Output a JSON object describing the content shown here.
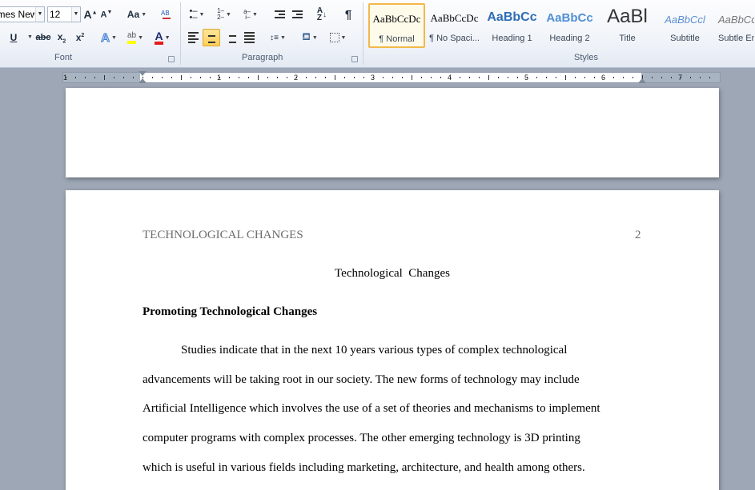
{
  "font_group": {
    "label": "Font",
    "font_name": "Times New Roman",
    "font_size": "12"
  },
  "paragraph_group": {
    "label": "Paragraph"
  },
  "styles_group": {
    "label": "Styles",
    "styles": [
      {
        "sample": "AaBbCcDc",
        "name": "¶ Normal"
      },
      {
        "sample": "AaBbCcDc",
        "name": "¶ No Spaci..."
      },
      {
        "sample": "AaBbCc",
        "name": "Heading 1"
      },
      {
        "sample": "AaBbCc",
        "name": "Heading 2"
      },
      {
        "sample": "AaBl",
        "name": "Title"
      },
      {
        "sample": "AaBbCcl",
        "name": "Subtitle"
      },
      {
        "sample": "AaBbCcDc",
        "name": "Subtle Em..."
      }
    ]
  },
  "ruler": {
    "numbers": [
      "1",
      "1",
      "2",
      "3",
      "4",
      "5",
      "6",
      "7"
    ]
  },
  "document": {
    "running_head": "TECHNOLOGICAL CHANGES",
    "page_number": "2",
    "title": "Technological  Changes",
    "heading": "Promoting Technological Changes",
    "lines": [
      "Studies indicate that in the next 10 years various types of complex technological",
      "advancements will be taking root in our society. The new forms of technology may include",
      "Artificial Intelligence which involves the use of a set of theories and mechanisms to implement",
      "computer programs with complex processes. The other emerging technology is 3D printing",
      "which is useful in various fields including marketing, architecture, and health among others."
    ]
  }
}
